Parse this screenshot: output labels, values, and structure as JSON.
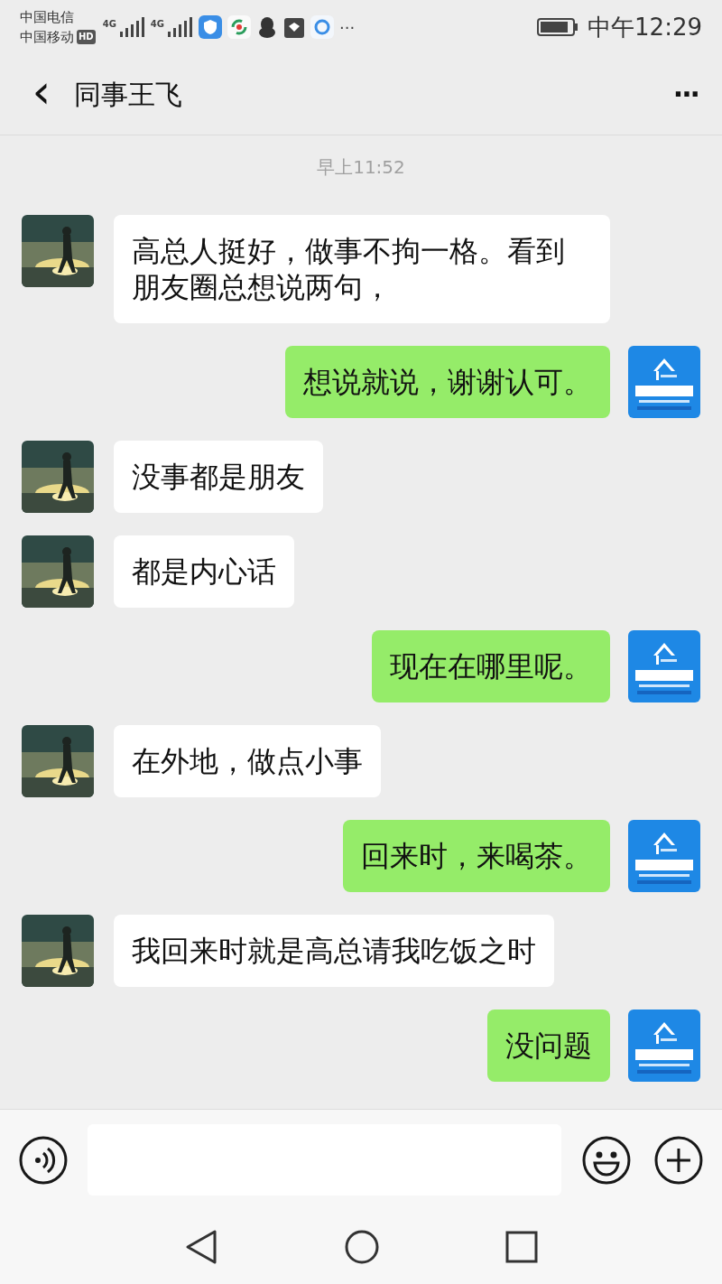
{
  "status_bar": {
    "carriers": [
      "中国电信",
      "中国移动"
    ],
    "hd_badge": "HD",
    "network_labels": [
      "4G",
      "4G"
    ],
    "more": "···",
    "time": "中午12:29"
  },
  "header": {
    "back": "‹",
    "title": "同事王飞",
    "more": "···"
  },
  "timestamp": "早上11:52",
  "messages": [
    {
      "kind": "received",
      "text": "高总人挺好，做事不拘一格。看到朋友圈总想说两句，"
    },
    {
      "kind": "sent",
      "text": "想说就说，谢谢认可。"
    },
    {
      "kind": "received",
      "text": "没事都是朋友"
    },
    {
      "kind": "received",
      "text": "都是内心话"
    },
    {
      "kind": "sent",
      "text": "现在在哪里呢。"
    },
    {
      "kind": "received",
      "text": "在外地，做点小事"
    },
    {
      "kind": "sent",
      "text": "回来时，来喝茶。"
    },
    {
      "kind": "received",
      "text": "我回来时就是高总请我吃饭之时"
    },
    {
      "kind": "sent",
      "text": "没问题"
    }
  ]
}
